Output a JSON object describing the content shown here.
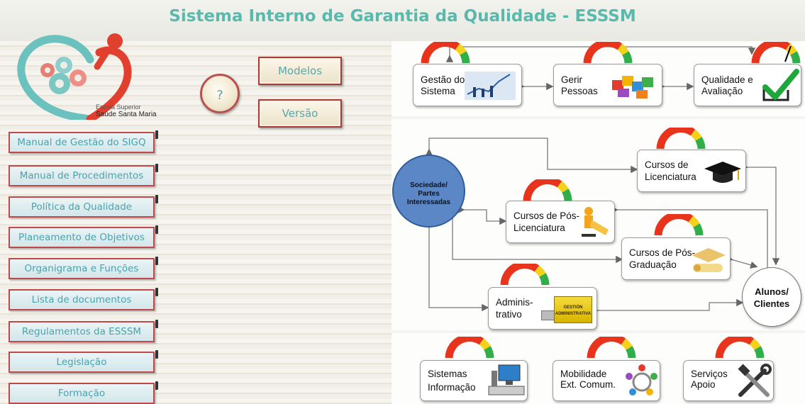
{
  "header": {
    "title": "Sistema Interno de Garantia da Qualidade - ESSSM"
  },
  "logo": {
    "line1": "Escola Superior",
    "line2": "Saúde Santa Maria"
  },
  "buttons": {
    "help": "?",
    "models": "Modelos",
    "version": "Versão"
  },
  "nav": [
    "Manual de Gestão do SIGQ",
    "Manual de Procedimentos",
    "Política da Qualidade",
    "Planeamento de Objetivos",
    "Organigrama e Funções",
    "Lista de documentos",
    "Regulamentos da ESSSM",
    "Legislação",
    "Formação"
  ],
  "process": {
    "top": [
      {
        "l1": "Gestão do",
        "l2": "Sistema"
      },
      {
        "l1": "Gerir",
        "l2": "Pessoas"
      },
      {
        "l1": "Qualidade e",
        "l2": "Avaliação"
      }
    ],
    "society": {
      "l1": "Sociedade/",
      "l2": "Partes",
      "l3": "Interessadas"
    },
    "students": {
      "l1": "Alunos/",
      "l2": "Clientes"
    },
    "middle": {
      "licenciatura": {
        "l1": "Cursos de",
        "l2": "Licenciatura"
      },
      "pos_licenciatura": {
        "l1": "Cursos de Pós-",
        "l2": "Licenciatura"
      },
      "pos_graduacao": {
        "l1": "Cursos de Pós-",
        "l2": "Graduação"
      },
      "administrativo": {
        "l1": "Adminis-",
        "l2": "trativo"
      }
    },
    "admin_tag": {
      "l1": "GESTIÓN",
      "l2": "ADMINISTRATIVA"
    },
    "bottom": [
      {
        "l1": "Sistemas",
        "l2": "Informação"
      },
      {
        "l1": "Mobilidade",
        "l2": "Ext. Comum."
      },
      {
        "l1": "Serviços",
        "l2": "Apoio"
      }
    ]
  },
  "colors": {
    "title": "#58b9ac",
    "nav_text": "#49a3ad",
    "nav_border": "#c0484a",
    "society": "#5b87c7",
    "gauge_red": "#e8341c",
    "gauge_yellow": "#f2d21b",
    "gauge_green": "#2fae4a"
  },
  "icons": [
    "heart-gears-logo-icon",
    "chart-people-icon",
    "puzzle-pieces-icon",
    "checkmark-box-icon",
    "graduation-cap-icon",
    "trophy-figure-icon",
    "diploma-scroll-icon",
    "usb-drive-icon",
    "computer-icon",
    "people-circle-icon",
    "tools-icon"
  ]
}
